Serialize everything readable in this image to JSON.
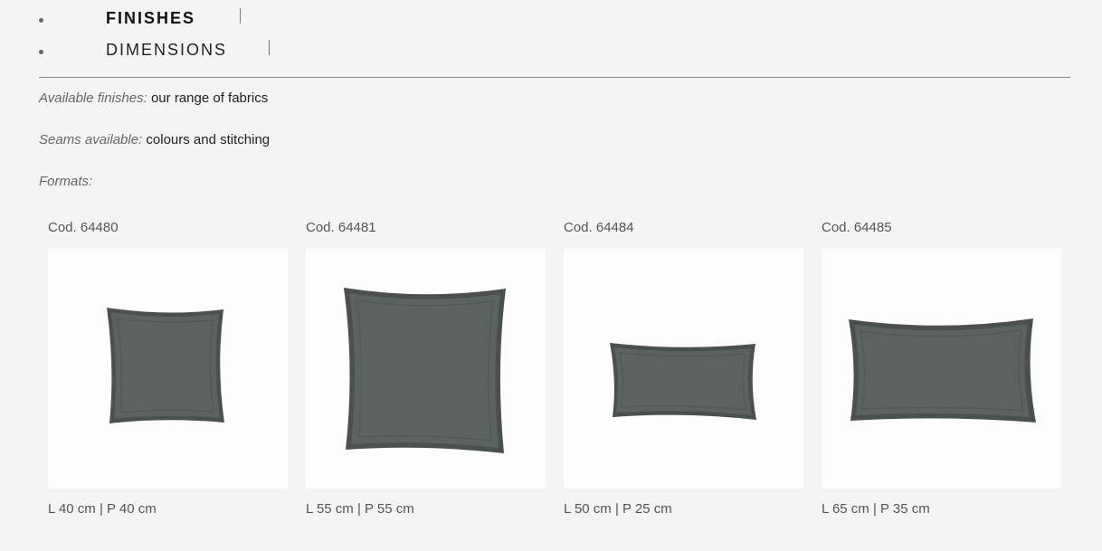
{
  "tabs": [
    {
      "label": "FINISHES",
      "active": true
    },
    {
      "label": "DIMENSIONS",
      "active": false
    }
  ],
  "info": {
    "finishes_key": "Available finishes:",
    "finishes_value": "our range of fabrics",
    "seams_key": "Seams available:",
    "seams_value": "colours and stitching",
    "formats_key": "Formats:"
  },
  "products": [
    {
      "code": "Cod. 64480",
      "dims": "L 40 cm |  P 40 cm",
      "icon": "square-cushion-small-image"
    },
    {
      "code": "Cod. 64481",
      "dims": "L 55 cm |  P 55 cm",
      "icon": "square-cushion-large-image"
    },
    {
      "code": "Cod. 64484",
      "dims": "L 50 cm |  P 25 cm",
      "icon": "rectangular-cushion-small-image"
    },
    {
      "code": "Cod. 64485",
      "dims": "L 65 cm |  P 35 cm",
      "icon": "rectangular-cushion-large-image"
    }
  ],
  "colors": {
    "background": "#f4f4f4",
    "cushion": "#5b625f",
    "cushion_edge": "#4a504d",
    "divider": "#888888"
  }
}
